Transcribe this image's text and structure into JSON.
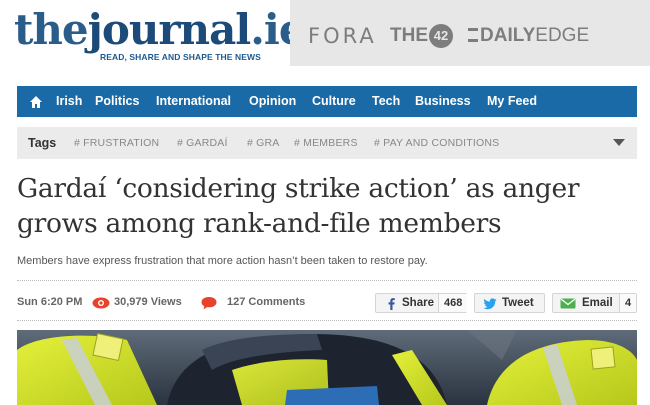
{
  "header": {
    "logo": {
      "the": "the",
      "journal": "journal",
      "ie": ".ie",
      "tagline": "READ, SHARE AND SHAPE THE NEWS"
    },
    "partners": [
      {
        "label": "FORA"
      },
      {
        "label": "THE",
        "badge": "42"
      },
      {
        "label_bold": "DAILY",
        "label_light": "EDGE"
      }
    ]
  },
  "nav": {
    "items": [
      "Irish",
      "Politics",
      "International",
      "Opinion",
      "Culture",
      "Tech",
      "Business",
      "My Feed"
    ],
    "bg_color": "#1a6aa7"
  },
  "tags": {
    "label": "Tags",
    "items": [
      "# FRUSTRATION",
      "# GARDAÍ",
      "# GRA",
      "# MEMBERS",
      "# PAY AND CONDITIONS"
    ]
  },
  "article": {
    "headline_line1": "Gardaí ‘considering strike action’ as anger",
    "headline_line2": "grows among rank-and-file members",
    "standfirst": "Members have express frustration that more action hasn’t been taken to restore pay.",
    "time": "Sun 6:20 PM",
    "views": "30,979 Views",
    "comments": "127 Comments"
  },
  "share": {
    "facebook": {
      "label": "Share",
      "count": "468",
      "icon": "facebook-icon",
      "color": "#3b5998"
    },
    "twitter": {
      "label": "Tweet",
      "icon": "twitter-icon",
      "color": "#2aa3ef"
    },
    "email": {
      "label": "Email",
      "count": "4",
      "icon": "mail-icon",
      "color": "#4caf50"
    }
  },
  "photo": {
    "subject": "garda officers in hi-vis jackets"
  }
}
